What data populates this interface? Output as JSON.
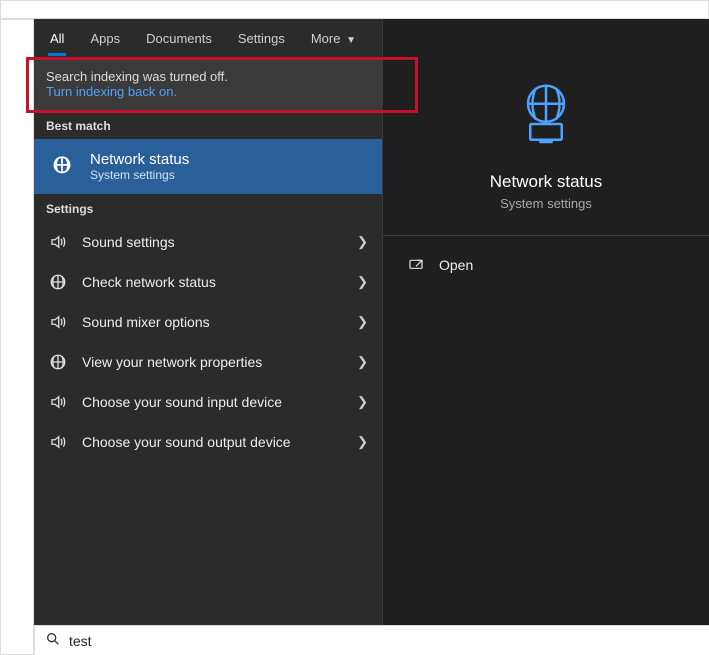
{
  "tabs": {
    "all": "All",
    "apps": "Apps",
    "documents": "Documents",
    "settings": "Settings",
    "more": "More"
  },
  "alert": {
    "message": "Search indexing was turned off.",
    "link": "Turn indexing back on."
  },
  "sections": {
    "best_match": "Best match",
    "settings": "Settings"
  },
  "best_match": {
    "title": "Network status",
    "subtitle": "System settings"
  },
  "settings_items": [
    {
      "icon": "sound",
      "label": "Sound settings"
    },
    {
      "icon": "globe",
      "label": "Check network status"
    },
    {
      "icon": "sound",
      "label": "Sound mixer options"
    },
    {
      "icon": "globe",
      "label": "View your network properties"
    },
    {
      "icon": "sound",
      "label": "Choose your sound input device"
    },
    {
      "icon": "sound",
      "label": "Choose your sound output device"
    }
  ],
  "detail": {
    "title": "Network status",
    "subtitle": "System settings",
    "actions": {
      "open": "Open"
    }
  },
  "search": {
    "value": "test"
  },
  "colors": {
    "accent": "#0078d4",
    "highlight_red": "#c8102e",
    "selected_bg": "#2a6099",
    "link": "#4da3ff"
  }
}
